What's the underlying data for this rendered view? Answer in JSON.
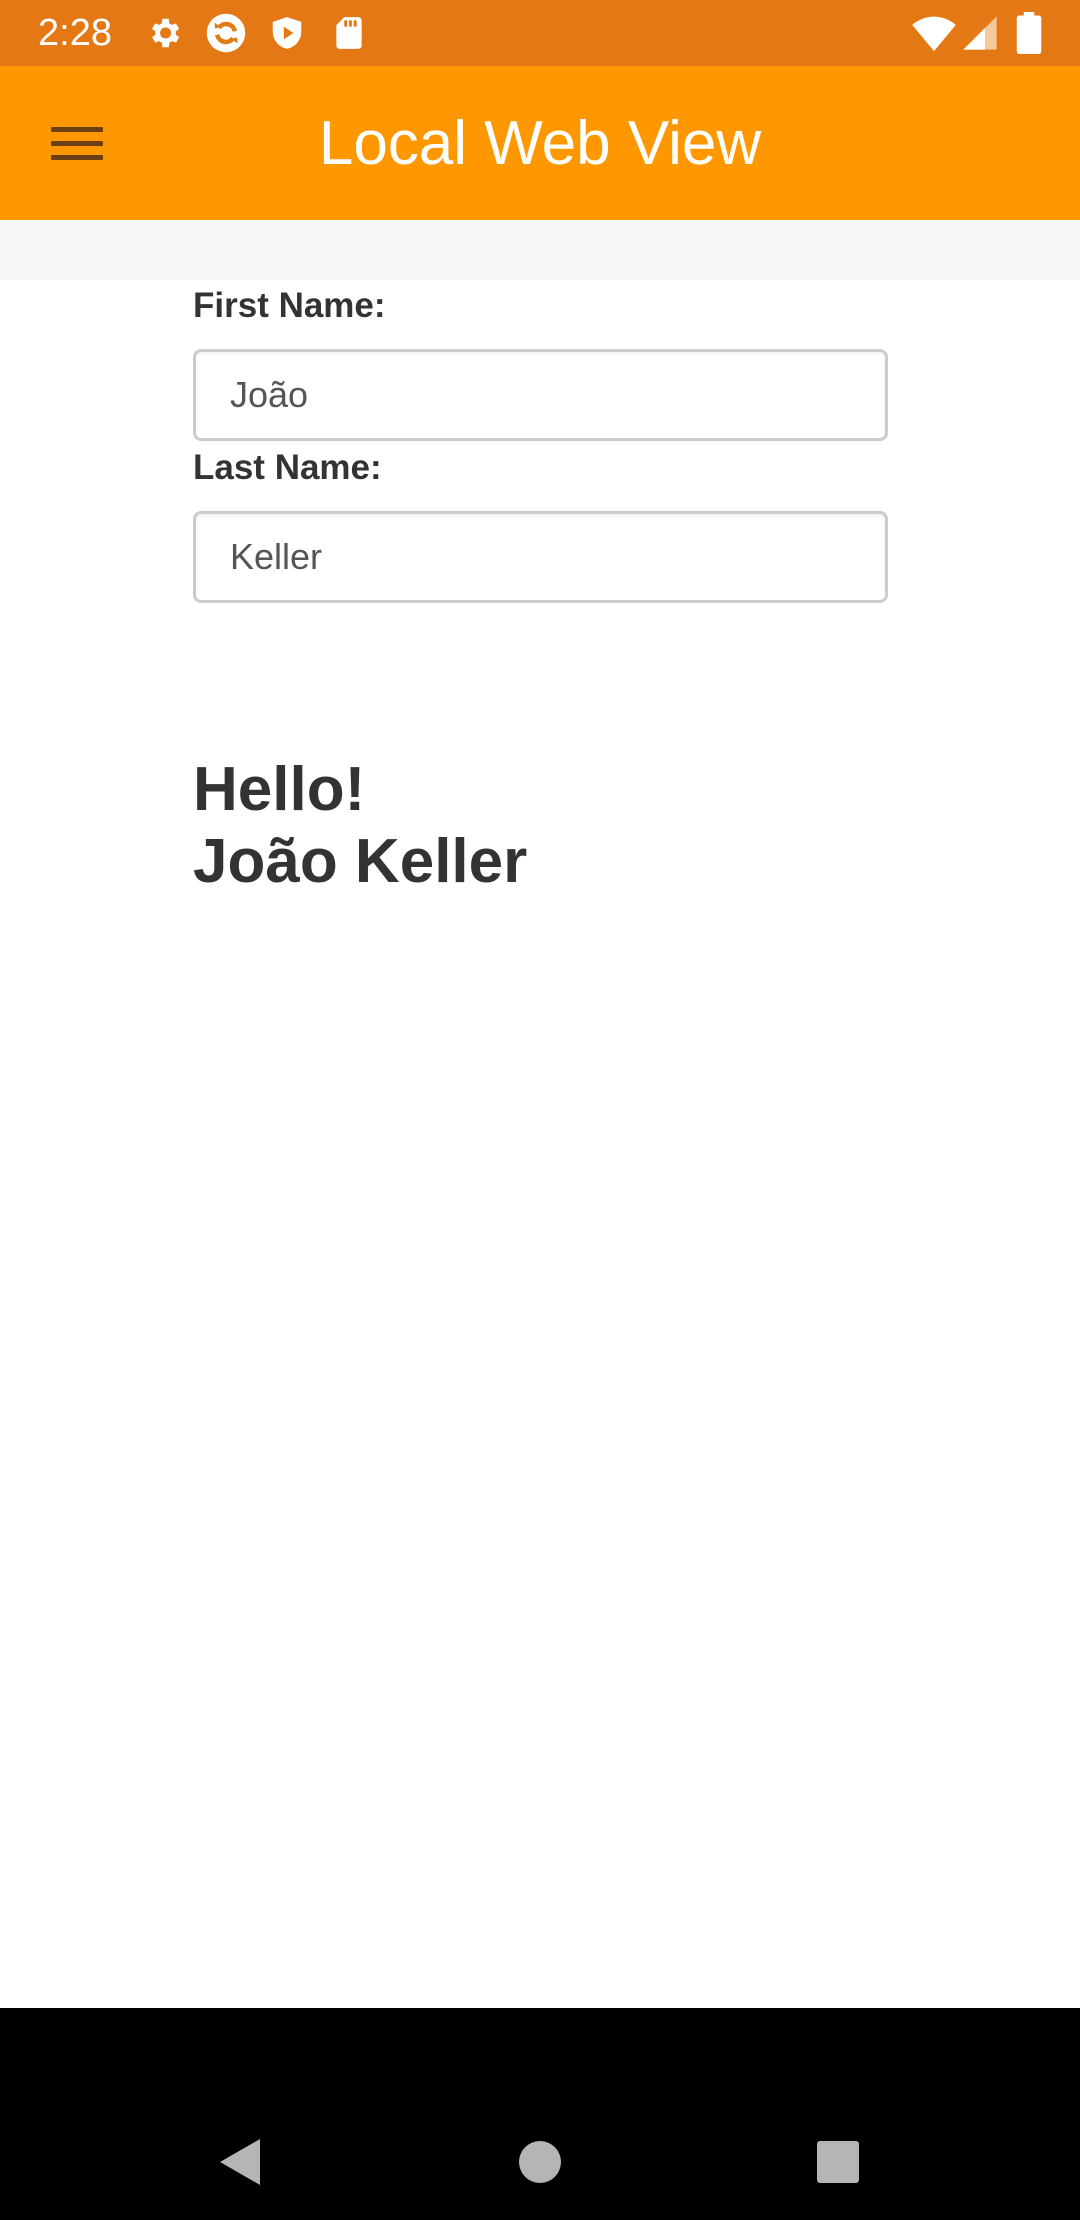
{
  "status_bar": {
    "time": "2:28",
    "left_icons": [
      "gear-icon",
      "sync-icon",
      "play-shield-icon",
      "sd-card-icon"
    ],
    "right_icons": [
      "wifi-icon",
      "cell-signal-icon",
      "battery-icon"
    ]
  },
  "app_bar": {
    "menu_icon": "hamburger-menu-icon",
    "title": "Local Web View"
  },
  "form": {
    "first_name_label": "First Name:",
    "first_name_value": "João",
    "last_name_label": "Last Name:",
    "last_name_value": "Keller"
  },
  "greeting": {
    "line1": "Hello!",
    "line2": "João Keller"
  },
  "nav_bar": {
    "icons": [
      "back-icon",
      "home-icon",
      "recents-icon"
    ]
  },
  "colors": {
    "status_bar": "#E47815",
    "app_bar": "#FF9800",
    "text_dark": "#333333"
  }
}
